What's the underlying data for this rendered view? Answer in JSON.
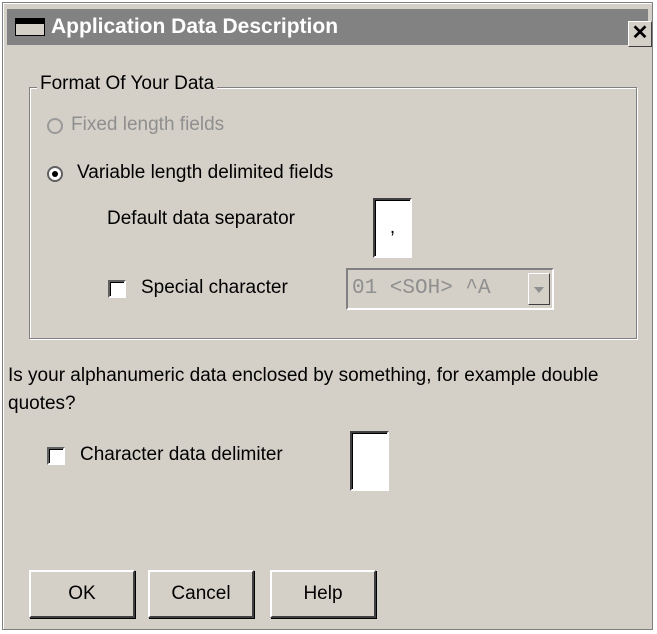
{
  "window": {
    "title": "Application Data Description",
    "close_glyph": "✕"
  },
  "format_group": {
    "legend": "Format Of Your Data",
    "fixed_label": "Fixed length fields",
    "fixed_selected": false,
    "fixed_enabled": false,
    "variable_label": "Variable length delimited fields",
    "variable_selected": true,
    "separator_label": "Default data separator",
    "separator_value": ",",
    "special_char_label": "Special character",
    "special_char_checked": false,
    "special_char_value": "01 <SOH> ^A"
  },
  "enclosure": {
    "question": "Is your alphanumeric data enclosed by something, for example double quotes?",
    "delimiter_label": "Character data delimiter",
    "delimiter_checked": false,
    "delimiter_value": ""
  },
  "buttons": {
    "ok": "OK",
    "cancel": "Cancel",
    "help": "Help"
  }
}
